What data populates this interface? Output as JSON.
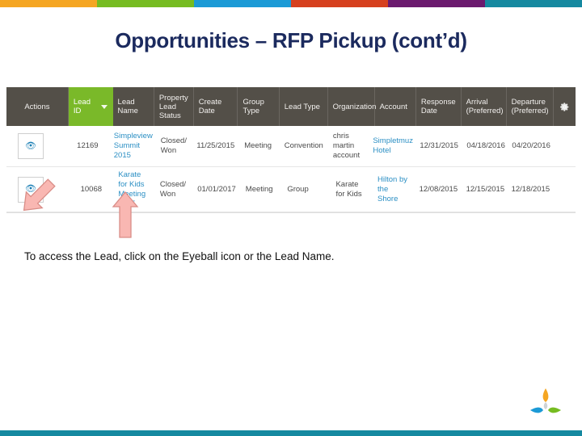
{
  "top_bar": {
    "colors": [
      "#F5A623",
      "#76BC21",
      "#1C9AD6",
      "#D6401E",
      "#6B1A6E",
      "#1589A0"
    ]
  },
  "slide": {
    "title": "Opportunities – RFP Pickup (cont’d)",
    "title_color": "#1b2a5e",
    "caption": "To access the Lead, click on the Eyeball icon or the Lead Name."
  },
  "grid": {
    "header_bg": "#534f48",
    "sorted_column_bg": "#7ab929",
    "link_color": "#2b8fc4",
    "columns": [
      {
        "key": "actions",
        "label": "Actions"
      },
      {
        "key": "lead_id",
        "label": "Lead ID",
        "sorted": true,
        "sort_icon": "chevron-down-icon"
      },
      {
        "key": "lead_name",
        "label": "Lead Name"
      },
      {
        "key": "status",
        "label": "Property Lead Status"
      },
      {
        "key": "create_date",
        "label": "Create Date"
      },
      {
        "key": "group_type",
        "label": "Group Type"
      },
      {
        "key": "lead_type",
        "label": "Lead Type"
      },
      {
        "key": "organization",
        "label": "Organization"
      },
      {
        "key": "account",
        "label": "Account"
      },
      {
        "key": "response_date",
        "label": "Response Date"
      },
      {
        "key": "arrival",
        "label": "Arrival (Preferred)"
      },
      {
        "key": "departure",
        "label": "Departure (Preferred)"
      }
    ],
    "settings_icon": "gear-icon",
    "rows": [
      {
        "action_icon": "eyeball-icon",
        "lead_id": "12169",
        "lead_name": "Simpleview Summit 2015",
        "status": "Closed/ Won",
        "create_date": "11/25/2015",
        "group_type": "Meeting",
        "lead_type": "Convention",
        "organization": "chris martin account",
        "account": "Simpletmuz Hotel",
        "response_date": "12/31/2015",
        "arrival": "04/18/2016",
        "departure": "04/20/2016"
      },
      {
        "action_icon": "eyeball-icon",
        "lead_id": "10068",
        "lead_name": "Karate for Kids Meeting 2015",
        "status": "Closed/ Won",
        "create_date": "01/01/2017",
        "group_type": "Meeting",
        "lead_type": "Group",
        "organization": "Karate for Kids",
        "account": "Hilton by the Shore",
        "response_date": "12/08/2015",
        "arrival": "12/15/2015",
        "departure": "12/18/2015"
      }
    ]
  },
  "annotations": [
    {
      "name": "arrow-to-eyeball-icon",
      "color": "#f7aaa6",
      "direction": "up-left"
    },
    {
      "name": "arrow-to-lead-name",
      "color": "#f7aaa6",
      "direction": "up"
    }
  ],
  "footer": {
    "bar_color": "#1589a0",
    "logo": "simpleview-logo",
    "logo_colors": [
      "#F5A623",
      "#1C9AD6",
      "#76BC21"
    ]
  }
}
